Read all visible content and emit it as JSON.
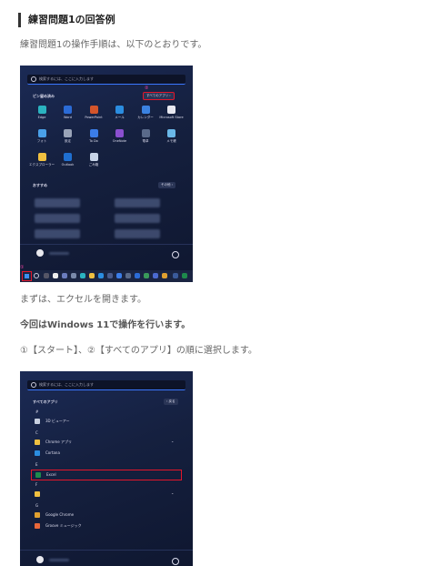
{
  "heading": "練習問題1の回答例",
  "intro": "練習問題1の操作手順は、以下のとおりです。",
  "steps": {
    "p1": "まずは、エクセルを開きます。",
    "p2": "今回はWindows 11で操作を行います。",
    "p3": "①【スタート】、②【すべてのアプリ】の順に選択します。"
  },
  "start_menu": {
    "search_placeholder": "検索するには、ここに入力します",
    "pinned_label": "ピン留め済み",
    "all_apps_button": "すべてのアプリ  ›",
    "step_marker": "②",
    "pinned_apps": [
      {
        "label": "Edge",
        "icon": "edge-icon",
        "color": "#2bb3c0"
      },
      {
        "label": "Word",
        "icon": "word-icon",
        "color": "#2b6bd6"
      },
      {
        "label": "PowerPoint",
        "icon": "powerpoint-icon",
        "color": "#d4552b"
      },
      {
        "label": "メール",
        "icon": "mail-icon",
        "color": "#2b8de0"
      },
      {
        "label": "カレンダー",
        "icon": "calendar-icon",
        "color": "#3b82e0"
      },
      {
        "label": "Microsoft Store",
        "icon": "store-icon",
        "color": "#e8e8f0"
      },
      {
        "label": "フォト",
        "icon": "photos-icon",
        "color": "#4aa0e8"
      },
      {
        "label": "設定",
        "icon": "settings-icon",
        "color": "#9aa4b8"
      },
      {
        "label": "To Do",
        "icon": "todo-icon",
        "color": "#3b7de8"
      },
      {
        "label": "OneNote",
        "icon": "onenote-icon",
        "color": "#8a4fcf"
      },
      {
        "label": "電卓",
        "icon": "calculator-icon",
        "color": "#5a6a8a"
      },
      {
        "label": "メモ帳",
        "icon": "notepad-icon",
        "color": "#6ab8e8"
      },
      {
        "label": "エクスプローラー",
        "icon": "folder-icon",
        "color": "#f0c040"
      },
      {
        "label": "Outlook",
        "icon": "outlook-icon",
        "color": "#1f6fd0"
      },
      {
        "label": "ごみ箱",
        "icon": "recycle-bin-icon",
        "color": "#c8d4e8"
      }
    ],
    "recommended_label": "おすすめ",
    "more_button": "その他  ›",
    "step_marker_start": "①"
  },
  "all_apps": {
    "search_placeholder": "検索するには、ここに入力します",
    "title": "すべてのアプリ",
    "back_button": "‹  戻る",
    "items": [
      {
        "type": "letter",
        "label": "#"
      },
      {
        "type": "app",
        "label": "3D ビューアー",
        "icon": "cube-icon",
        "color": "#c8d0e0"
      },
      {
        "type": "letter",
        "label": "C"
      },
      {
        "type": "app",
        "label": "Chrome アプリ",
        "icon": "folder-icon",
        "color": "#f0c040",
        "chevron": "⌄"
      },
      {
        "type": "app",
        "label": "Cortana",
        "icon": "cortana-icon",
        "color": "#2b8de0"
      },
      {
        "type": "letter",
        "label": "E"
      },
      {
        "type": "app",
        "label": "Excel",
        "icon": "excel-icon",
        "color": "#1e8a4c",
        "highlight": true
      },
      {
        "type": "letter",
        "label": "F"
      },
      {
        "type": "app",
        "label": "",
        "icon": "folder-icon",
        "color": "#f0c040",
        "chevron": "⌄"
      },
      {
        "type": "letter",
        "label": "G"
      },
      {
        "type": "app",
        "label": "Google Chrome",
        "icon": "chrome-icon",
        "color": "#e0a030"
      },
      {
        "type": "app",
        "label": "Groove ミュージック",
        "icon": "groove-icon",
        "color": "#e8673a"
      }
    ]
  }
}
